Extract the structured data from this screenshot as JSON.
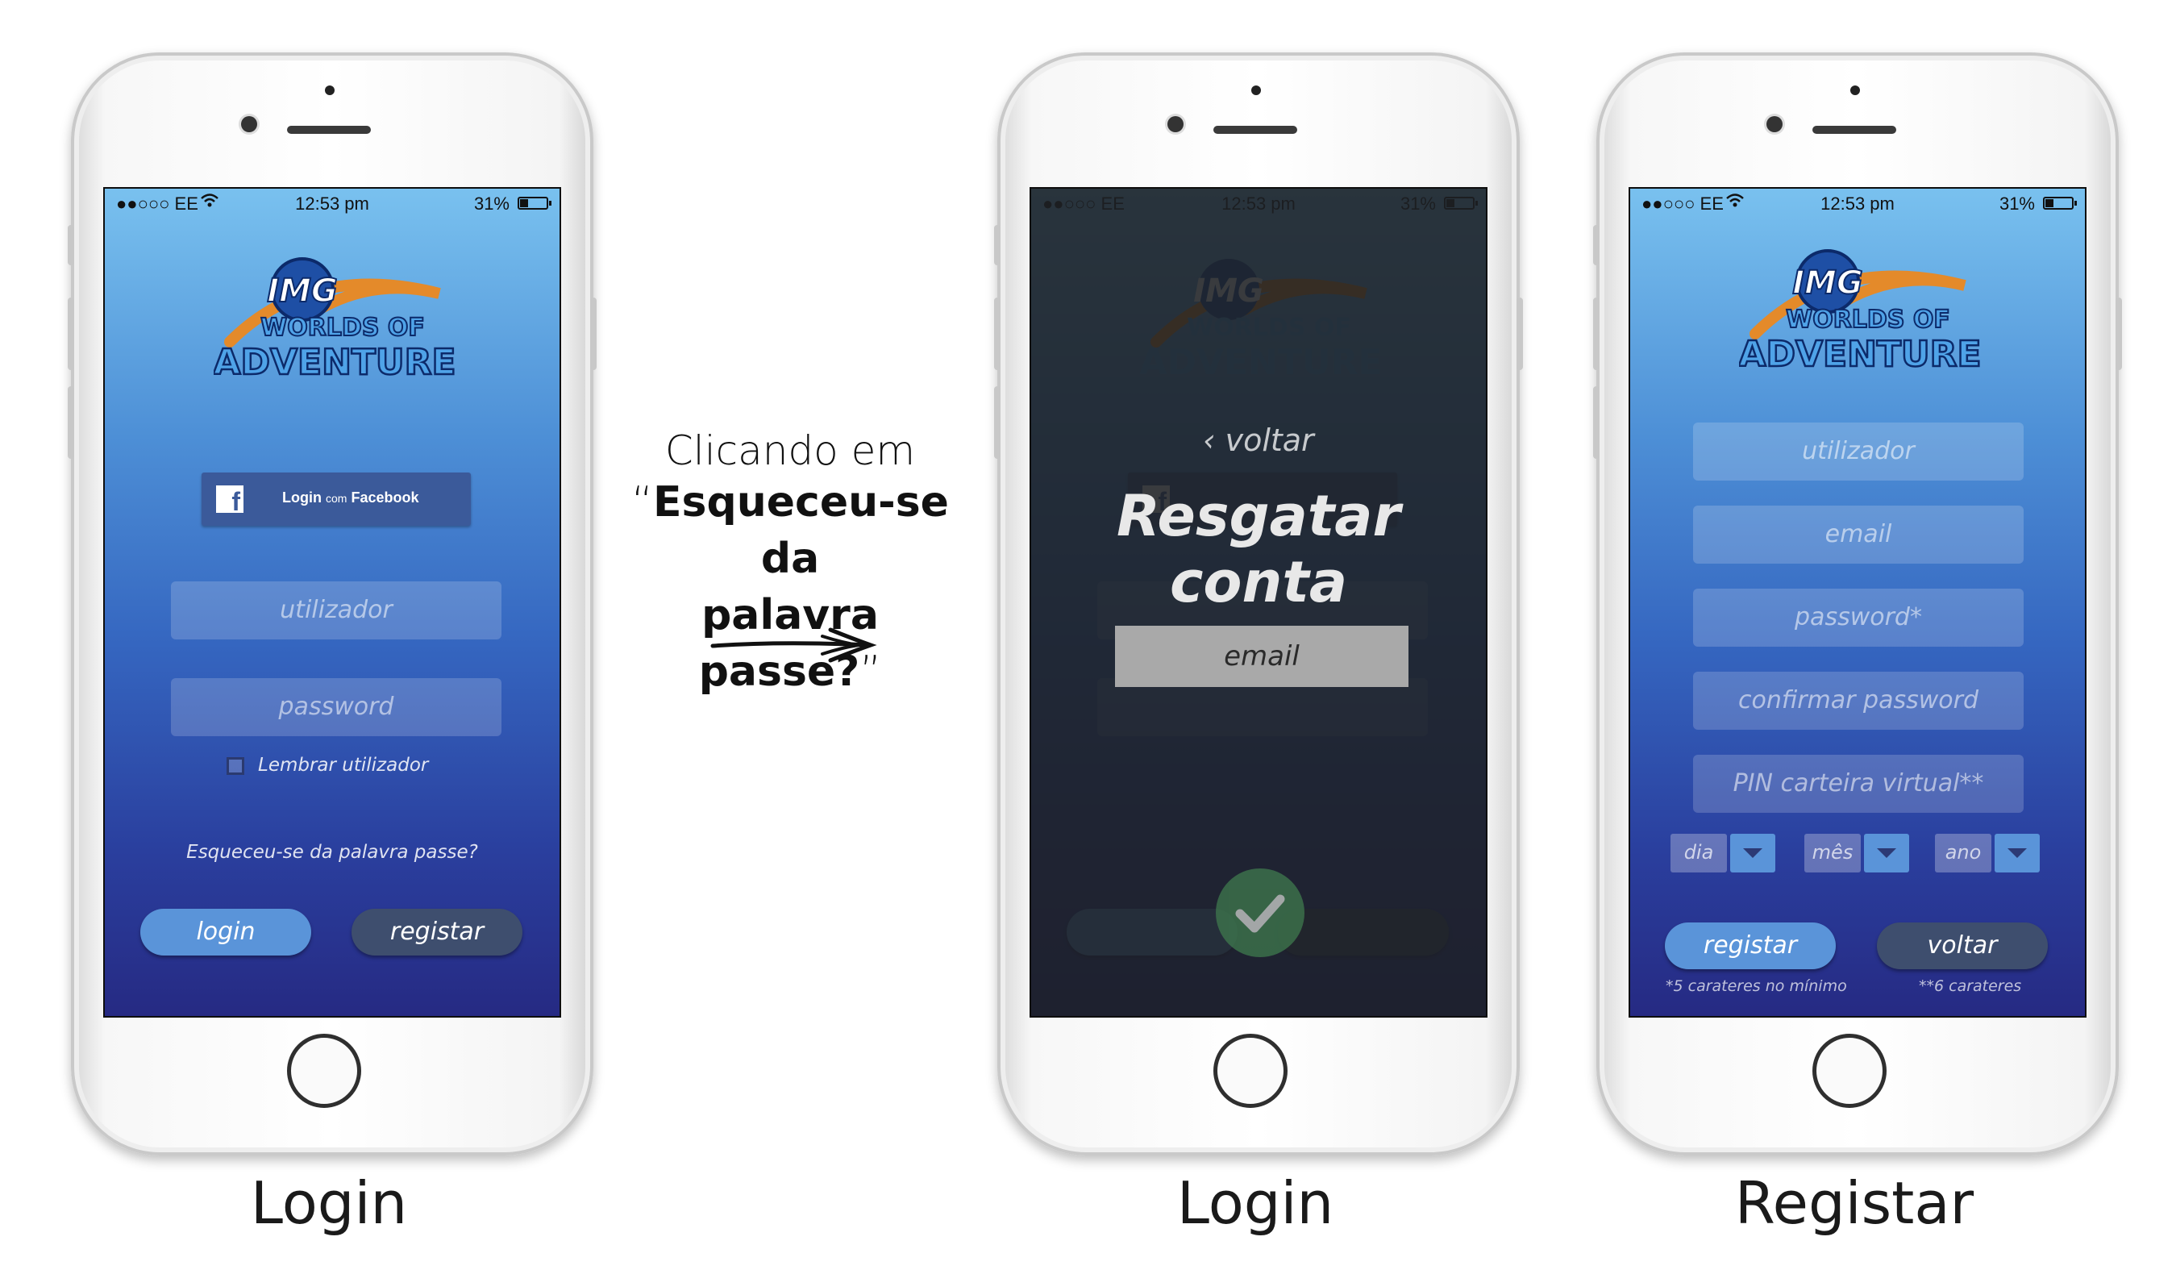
{
  "status_bar": {
    "carrier": "●●○○○ EE",
    "time": "12:53 pm",
    "battery": "31%"
  },
  "logo": {
    "line1": "IMG",
    "line2": "WORLDS OF",
    "line3": "ADVENTURE"
  },
  "screen_login": {
    "facebook_login": {
      "prefix": "Login",
      "middle": "com",
      "suffix": "Facebook"
    },
    "username_placeholder": "utilizador",
    "password_placeholder": "password",
    "remember_label": "Lembrar utilizador",
    "forgot_link": "Esqueceu-se da palavra passe?",
    "login_button": "login",
    "register_button": "registar",
    "caption": "Login"
  },
  "annotation": {
    "line1": "Clicando em",
    "line2_open": "“",
    "line2": "Esqueceu-se da",
    "line3": "palavra passe?",
    "line3_close": "”"
  },
  "screen_recover": {
    "back_label": "voltar",
    "title": "Resgatar conta",
    "email_placeholder": "email",
    "caption": "Login"
  },
  "screen_register": {
    "username_placeholder": "utilizador",
    "email_placeholder": "email",
    "password_placeholder": "password*",
    "confirm_placeholder": "confirmar password",
    "pin_placeholder": "PIN carteira virtual**",
    "day_label": "dia",
    "month_label": "mês",
    "year_label": "ano",
    "register_button": "registar",
    "back_button": "voltar",
    "note_password": "*5 carateres no mínimo",
    "note_pin": "**6 carateres",
    "caption": "Registar"
  },
  "colors": {
    "fb_blue": "#3b5a9a",
    "button_blue": "#5a94d9",
    "button_dark": "#3e4e6e",
    "check_green": "#3f7a4e"
  }
}
